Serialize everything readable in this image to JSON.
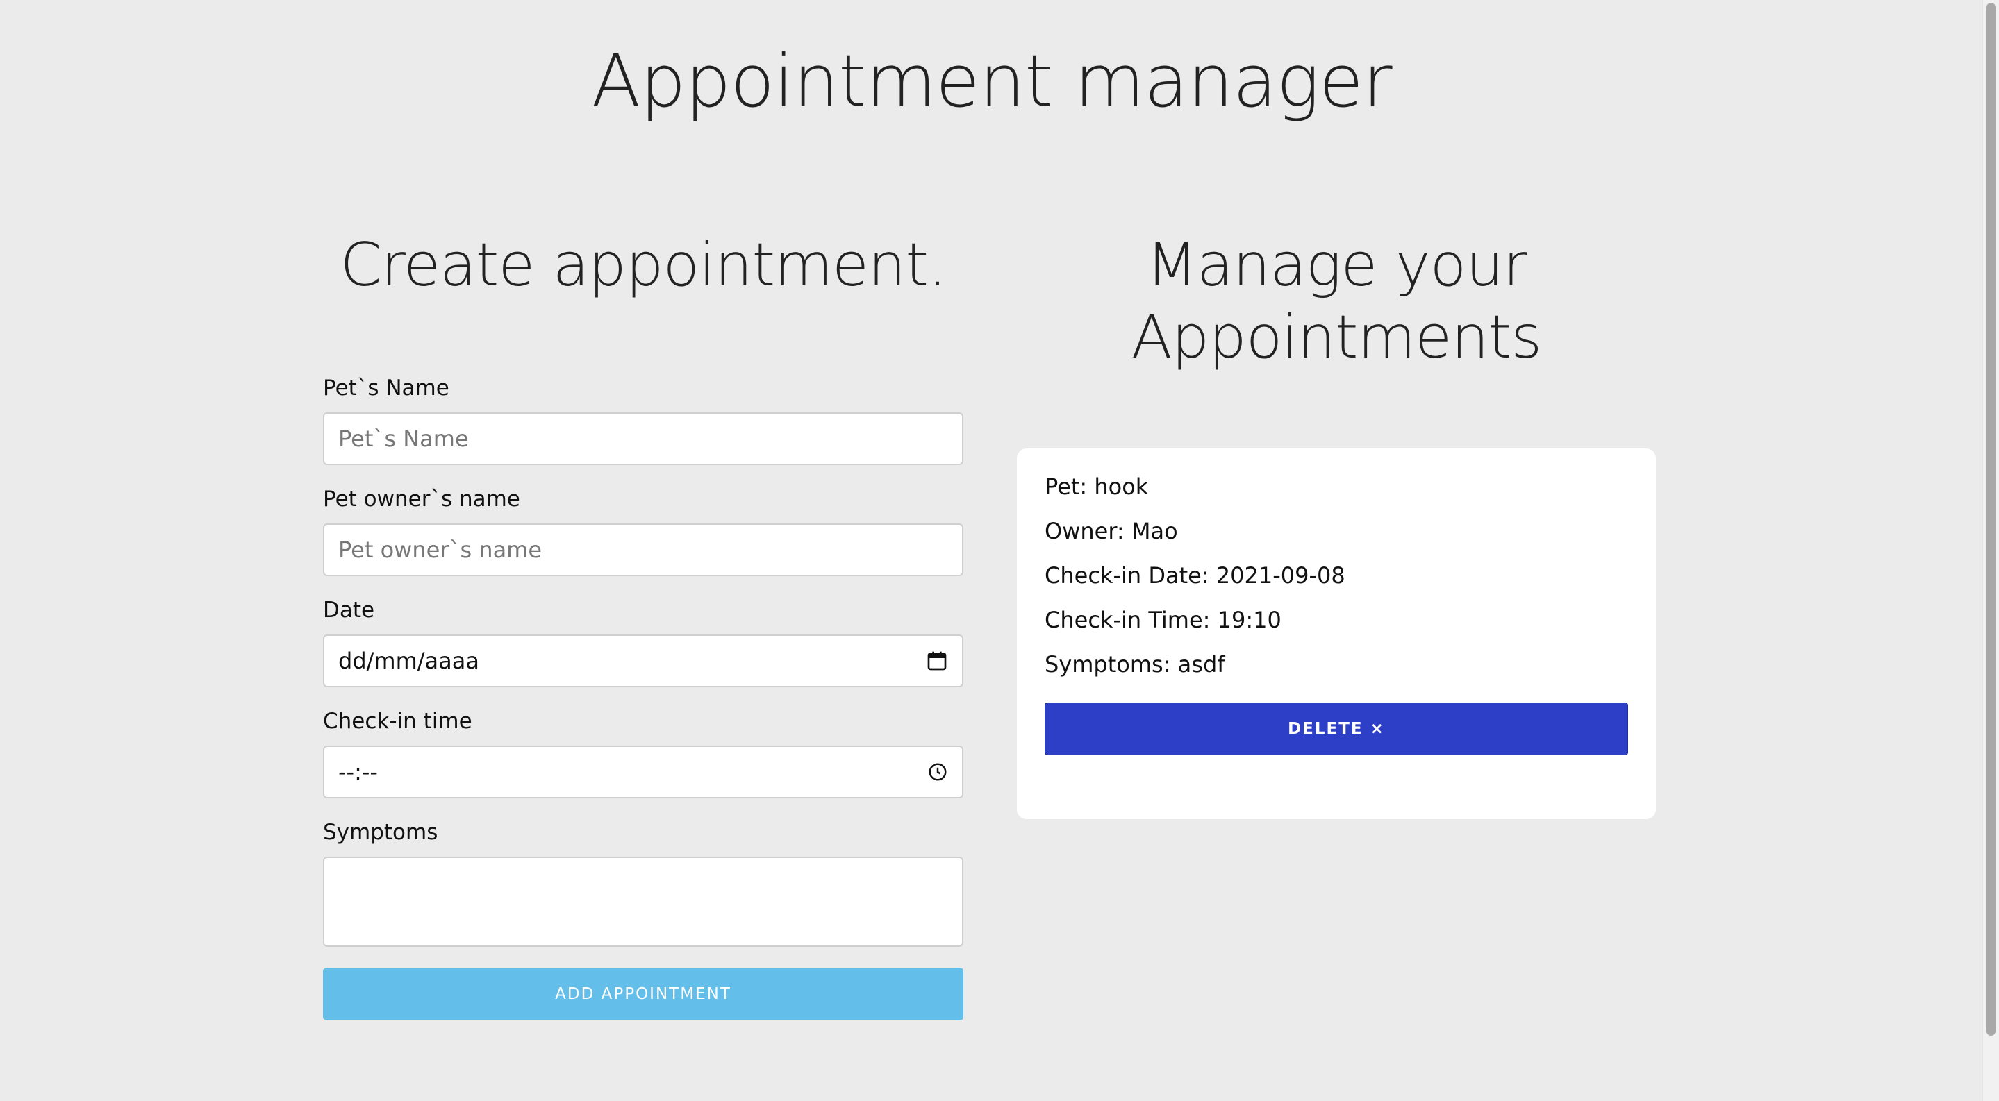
{
  "header": {
    "title": "Appointment manager"
  },
  "create": {
    "title": "Create appointment.",
    "fields": {
      "pet_name": {
        "label": "Pet`s Name",
        "placeholder": "Pet`s Name"
      },
      "owner_name": {
        "label": "Pet owner`s name",
        "placeholder": "Pet owner`s name"
      },
      "date": {
        "label": "Date",
        "value": "dd/mm/aaaa"
      },
      "time": {
        "label": "Check-in time",
        "value": "--:--"
      },
      "symptoms": {
        "label": "Symptoms",
        "value": ""
      }
    },
    "submit_label": "ADD APPOINTMENT"
  },
  "manage": {
    "title": "Manage your Appointments",
    "appointments": [
      {
        "pet_label": "Pet:",
        "pet": "hook",
        "owner_label": "Owner:",
        "owner": "Mao",
        "date_label": "Check-in Date:",
        "date": "2021-09-08",
        "time_label": "Check-in Time:",
        "time": "19:10",
        "symptoms_label": "Symptoms:",
        "symptoms": "asdf",
        "delete_label": "DELETE ×"
      }
    ]
  },
  "colors": {
    "add_button": "#63bfea",
    "delete_button": "#2d3fc6",
    "background": "#ebebeb"
  }
}
